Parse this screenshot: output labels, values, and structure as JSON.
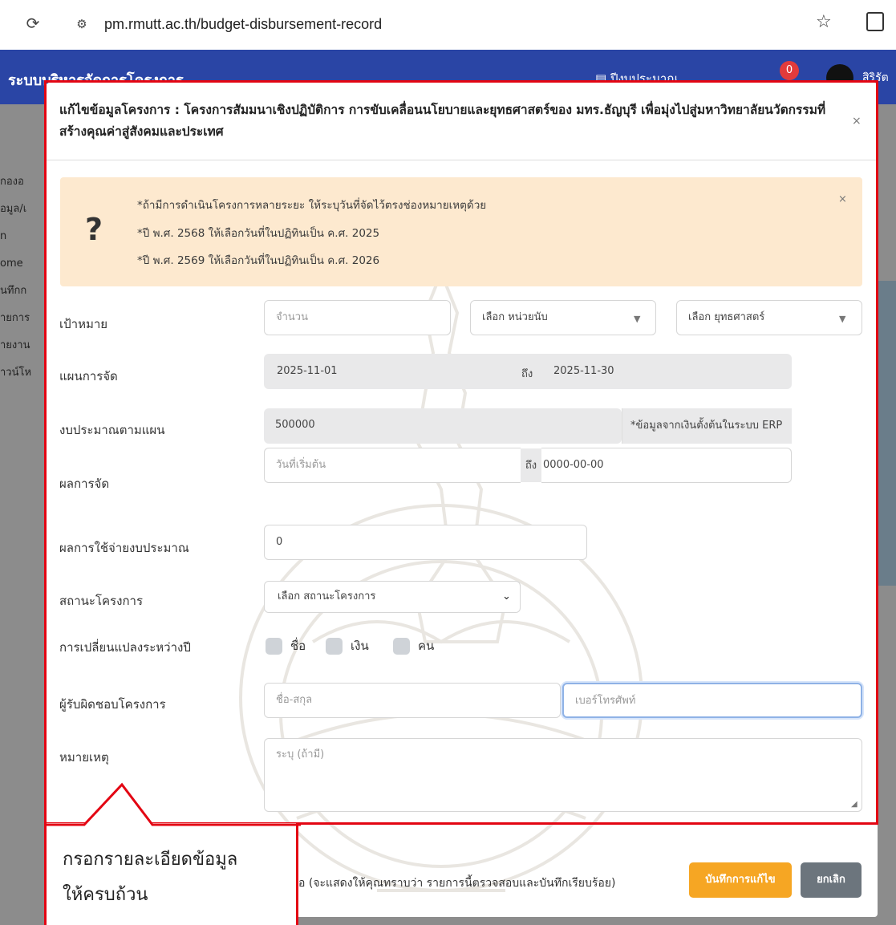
{
  "browser": {
    "url": "pm.rmutt.ac.th/budget-disbursement-record"
  },
  "app": {
    "title": "ระบบบริหารจัดการโครงการ",
    "fiscal_year_label": "ปีงบประมาณ",
    "notification_count": "0",
    "user_name": "สิริรัต",
    "sidebar_fragments": [
      "กองอ",
      "อมูล/เ",
      "n",
      "ome",
      "นทึกก",
      "ายการ",
      "ายงาน",
      "าวน์โห"
    ]
  },
  "modal": {
    "title": "แก้ไขข้อมูลโครงการ : โครงการสัมมนาเชิงปฏิบัติการ การขับเคลื่อนนโยบายและยุทธศาสตร์ของ มทร.ธัญบุรี เพื่อมุ่งไปสู่มหาวิทยาลัยนวัตกรรมที่สร้างคุณค่าสู่สังคมและประเทศ",
    "close": "×",
    "alert": {
      "lines": [
        "*ถ้ามีการดำเนินโครงการหลายระยะ ให้ระบุวันที่จัดไว้ตรงช่องหมายเหตุด้วย",
        "*ปี พ.ศ. 2568 ให้เลือกวันที่ในปฏิทินเป็น ค.ศ. 2025",
        "*ปี พ.ศ. 2569 ให้เลือกวันที่ในปฏิทินเป็น ค.ศ. 2026"
      ],
      "close": "×"
    },
    "fields": {
      "target": {
        "label": "เป้าหมาย",
        "amount_placeholder": "จำนวน",
        "unit_select": "เลือก หน่วยนับ",
        "strategy_select": "เลือก ยุทธศาสตร์"
      },
      "plan": {
        "label": "แผนการจัด",
        "from": "2025-11-01",
        "to_label": "ถึง",
        "to": "2025-11-30"
      },
      "budget_plan": {
        "label": "งบประมาณตามแผน",
        "value": "500000",
        "note": "*ข้อมูลจากเงินตั้งต้นในระบบ ERP"
      },
      "result": {
        "label": "ผลการจัด",
        "start_placeholder": "วันที่เริ่มต้น",
        "to_label": "ถึง",
        "to": "0000-00-00"
      },
      "spend": {
        "label": "ผลการใช้จ่ายงบประมาณ",
        "value": "0"
      },
      "status": {
        "label": "สถานะโครงการ",
        "select": "เลือก สถานะโครงการ"
      },
      "change": {
        "label": "การเปลี่ยนแปลงระหว่างปี",
        "options": [
          "ชื่อ",
          "เงิน",
          "คน"
        ]
      },
      "owner": {
        "label": "ผู้รับผิดชอบโครงการ",
        "name_placeholder": "ชื่อ-สกุล",
        "phone_placeholder": "เบอร์โทรศัพท์"
      },
      "remark": {
        "label": "หมายเหตุ",
        "placeholder": "ระบุ (ถ้ามี)"
      }
    },
    "footer": {
      "confirm_text": "อ (จะแสดงให้คุณทราบว่า รายการนี้ตรวจสอบและบันทึกเรียบร้อย)",
      "save_button": "บันทึกการแก้ไข",
      "cancel_button": "ยกเลิก"
    }
  },
  "callout": {
    "lines": [
      "กรอกรายละเอียดข้อมูล",
      "ให้ครบถ้วน"
    ]
  },
  "colors": {
    "header_blue": "#2a45a5",
    "highlight_red": "#e30613",
    "alert_bg": "#fde9cf",
    "save_orange": "#f6a623",
    "cancel_grey": "#6c757d"
  }
}
